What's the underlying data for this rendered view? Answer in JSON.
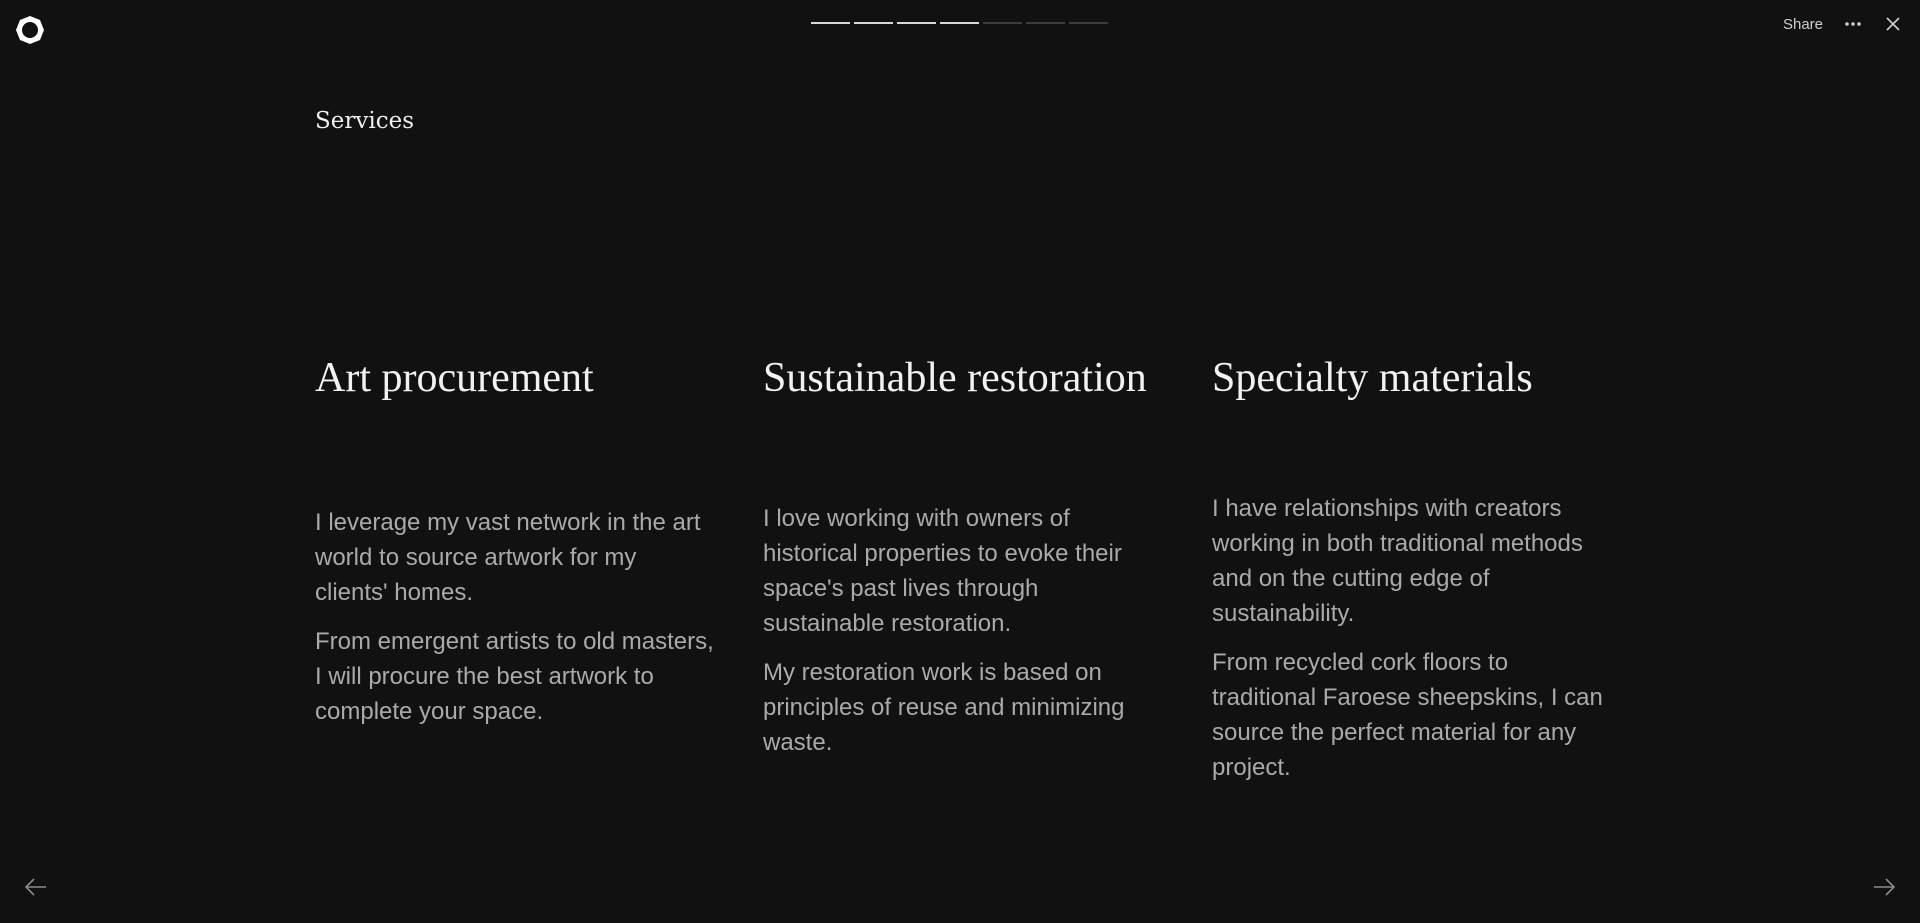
{
  "header": {
    "logo_icon": "logo-icon",
    "progress": {
      "total": 7,
      "completed": 4
    },
    "share_label": "Share",
    "more_icon": "more-icon",
    "close_icon": "close-icon"
  },
  "page": {
    "title": "Services"
  },
  "services": [
    {
      "title": "Art procurement",
      "paragraphs": [
        "I leverage my vast network in the art world to source artwork for my clients' homes.",
        "From emergent artists to old masters, I will procure the best artwork to complete your space."
      ]
    },
    {
      "title": "Sustainable restoration",
      "paragraphs": [
        "I love working with owners of historical properties to evoke their space's past lives through sustainable restoration.",
        "My restoration work is based on principles of reuse and minimizing waste."
      ]
    },
    {
      "title": "Specialty materials",
      "paragraphs": [
        "I have relationships with creators working in both traditional methods and on the cutting edge of sustainability.",
        "From recycled cork floors to traditional Faroese sheepskins, I can source the perfect material for any project."
      ]
    }
  ],
  "footer": {
    "prev_icon": "arrow-left-icon",
    "next_icon": "arrow-right-icon"
  },
  "colors": {
    "background": "#111111",
    "heading": "#f2f2f2",
    "body_text": "#aaaaaa",
    "progress_done": "#d8d8d8",
    "progress_todo": "#3c3c3c"
  }
}
